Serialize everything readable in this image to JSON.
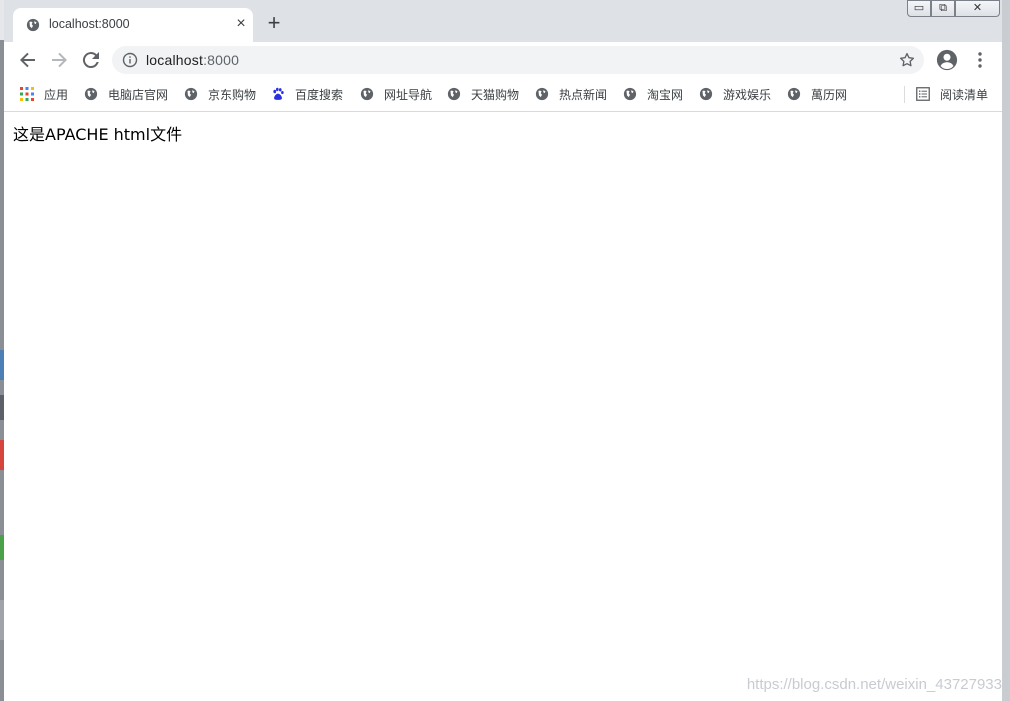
{
  "tab": {
    "title": "localhost:8000",
    "close_label": "×"
  },
  "new_tab_label": "+",
  "window_controls": {
    "minimize": "▭",
    "maximize": "⧉",
    "close": "✕"
  },
  "omnibox": {
    "host": "localhost",
    "port": ":8000"
  },
  "bookmarks": {
    "items": [
      {
        "label": "应用",
        "icon": "apps-grid-icon"
      },
      {
        "label": "电脑店官网",
        "icon": "globe-icon"
      },
      {
        "label": "京东购物",
        "icon": "globe-icon"
      },
      {
        "label": "百度搜索",
        "icon": "baidu-paw-icon"
      },
      {
        "label": "网址导航",
        "icon": "globe-icon"
      },
      {
        "label": "天猫购物",
        "icon": "globe-icon"
      },
      {
        "label": "热点新闻",
        "icon": "globe-icon"
      },
      {
        "label": "淘宝网",
        "icon": "globe-icon"
      },
      {
        "label": "游戏娱乐",
        "icon": "globe-icon"
      },
      {
        "label": "萬历网",
        "icon": "globe-icon"
      }
    ],
    "reading_list": {
      "label": "阅读清单",
      "icon": "reading-list-icon"
    }
  },
  "page": {
    "text": "这是APACHE html文件"
  },
  "watermark": "https://blog.csdn.net/weixin_43727933",
  "colors": {
    "tabstrip_bg": "#dee1e6",
    "omnibox_bg": "#f1f3f4",
    "icon_gray": "#5f6368",
    "baidu_blue": "#2932e1"
  }
}
